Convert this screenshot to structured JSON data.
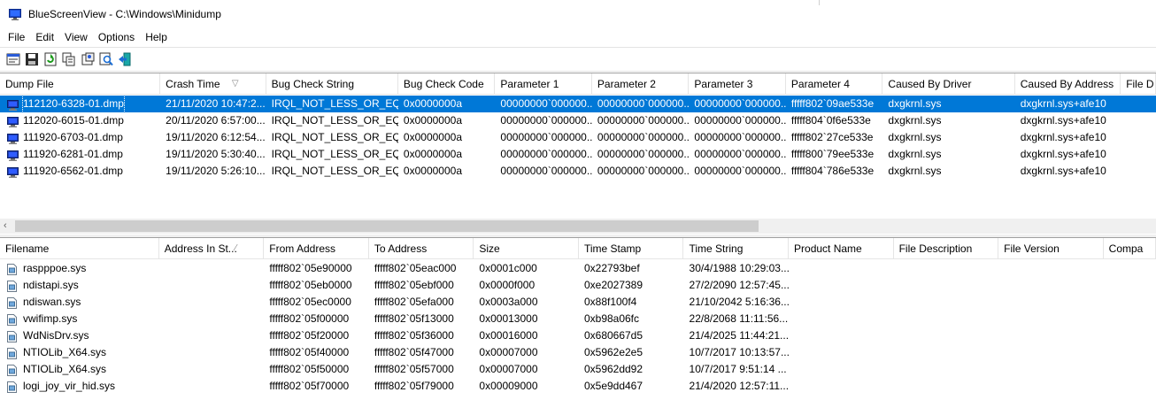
{
  "window": {
    "title": "BlueScreenView  -  C:\\Windows\\Minidump"
  },
  "menu": [
    "File",
    "Edit",
    "View",
    "Options",
    "Help"
  ],
  "toolbar": {
    "buttons": [
      "properties-icon",
      "save-icon",
      "refresh-icon",
      "copy-icon",
      "html-report-icon",
      "find-icon",
      "exit-icon"
    ]
  },
  "crash_list": {
    "columns": [
      {
        "label": "Dump File",
        "sorted": false
      },
      {
        "label": "Crash Time",
        "sorted": true
      },
      {
        "label": "Bug Check String",
        "sorted": false
      },
      {
        "label": "Bug Check Code",
        "sorted": false
      },
      {
        "label": "Parameter 1",
        "sorted": false
      },
      {
        "label": "Parameter 2",
        "sorted": false
      },
      {
        "label": "Parameter 3",
        "sorted": false
      },
      {
        "label": "Parameter 4",
        "sorted": false
      },
      {
        "label": "Caused By Driver",
        "sorted": false
      },
      {
        "label": "Caused By Address",
        "sorted": false
      },
      {
        "label": "File D",
        "sorted": false
      }
    ],
    "sort_arrow": "▽",
    "rows": [
      [
        "112120-6328-01.dmp",
        "21/11/2020 10:47:2...",
        "IRQL_NOT_LESS_OR_EQ...",
        "0x0000000a",
        "00000000`000000...",
        "00000000`000000...",
        "00000000`000000...",
        "fffff802`09ae533e",
        "dxgkrnl.sys",
        "dxgkrnl.sys+afe10",
        ""
      ],
      [
        "112020-6015-01.dmp",
        "20/11/2020 6:57:00...",
        "IRQL_NOT_LESS_OR_EQ...",
        "0x0000000a",
        "00000000`000000...",
        "00000000`000000...",
        "00000000`000000...",
        "fffff804`0f6e533e",
        "dxgkrnl.sys",
        "dxgkrnl.sys+afe10",
        ""
      ],
      [
        "111920-6703-01.dmp",
        "19/11/2020 6:12:54...",
        "IRQL_NOT_LESS_OR_EQ...",
        "0x0000000a",
        "00000000`000000...",
        "00000000`000000...",
        "00000000`000000...",
        "fffff802`27ce533e",
        "dxgkrnl.sys",
        "dxgkrnl.sys+afe10",
        ""
      ],
      [
        "111920-6281-01.dmp",
        "19/11/2020 5:30:40...",
        "IRQL_NOT_LESS_OR_EQ...",
        "0x0000000a",
        "00000000`000000...",
        "00000000`000000...",
        "00000000`000000...",
        "fffff800`79ee533e",
        "dxgkrnl.sys",
        "dxgkrnl.sys+afe10",
        ""
      ],
      [
        "111920-6562-01.dmp",
        "19/11/2020 5:26:10...",
        "IRQL_NOT_LESS_OR_EQ...",
        "0x0000000a",
        "00000000`000000...",
        "00000000`000000...",
        "00000000`000000...",
        "fffff804`786e533e",
        "dxgkrnl.sys",
        "dxgkrnl.sys+afe10",
        ""
      ]
    ],
    "selected_row": 0
  },
  "driver_list": {
    "columns": [
      {
        "label": "Filename",
        "sorted": false
      },
      {
        "label": "Address In St...",
        "sorted": true
      },
      {
        "label": "From Address",
        "sorted": false
      },
      {
        "label": "To Address",
        "sorted": false
      },
      {
        "label": "Size",
        "sorted": false
      },
      {
        "label": "Time Stamp",
        "sorted": false
      },
      {
        "label": "Time String",
        "sorted": false
      },
      {
        "label": "Product Name",
        "sorted": false
      },
      {
        "label": "File Description",
        "sorted": false
      },
      {
        "label": "File Version",
        "sorted": false
      },
      {
        "label": "Compa",
        "sorted": false
      }
    ],
    "sort_arrow": "⁄",
    "rows": [
      [
        "raspppoe.sys",
        "",
        "fffff802`05e90000",
        "fffff802`05eac000",
        "0x0001c000",
        "0x22793bef",
        "30/4/1988 10:29:03...",
        "",
        "",
        "",
        ""
      ],
      [
        "ndistapi.sys",
        "",
        "fffff802`05eb0000",
        "fffff802`05ebf000",
        "0x0000f000",
        "0xe2027389",
        "27/2/2090 12:57:45...",
        "",
        "",
        "",
        ""
      ],
      [
        "ndiswan.sys",
        "",
        "fffff802`05ec0000",
        "fffff802`05efa000",
        "0x0003a000",
        "0x88f100f4",
        "21/10/2042 5:16:36...",
        "",
        "",
        "",
        ""
      ],
      [
        "vwifimp.sys",
        "",
        "fffff802`05f00000",
        "fffff802`05f13000",
        "0x00013000",
        "0xb98a06fc",
        "22/8/2068 11:11:56...",
        "",
        "",
        "",
        ""
      ],
      [
        "WdNisDrv.sys",
        "",
        "fffff802`05f20000",
        "fffff802`05f36000",
        "0x00016000",
        "0x680667d5",
        "21/4/2025 11:44:21...",
        "",
        "",
        "",
        ""
      ],
      [
        "NTIOLib_X64.sys",
        "",
        "fffff802`05f40000",
        "fffff802`05f47000",
        "0x00007000",
        "0x5962e2e5",
        "10/7/2017 10:13:57...",
        "",
        "",
        "",
        ""
      ],
      [
        "NTIOLib_X64.sys",
        "",
        "fffff802`05f50000",
        "fffff802`05f57000",
        "0x00007000",
        "0x5962dd92",
        "10/7/2017 9:51:14 ...",
        "",
        "",
        "",
        ""
      ],
      [
        "logi_joy_vir_hid.sys",
        "",
        "fffff802`05f70000",
        "fffff802`05f79000",
        "0x00009000",
        "0x5e9dd467",
        "21/4/2020 12:57:11...",
        "",
        "",
        "",
        ""
      ]
    ]
  },
  "colors": {
    "selection": "#0078d7",
    "scroll_thumb": "#cdcdcd",
    "scroll_track": "#f0f0f0"
  }
}
